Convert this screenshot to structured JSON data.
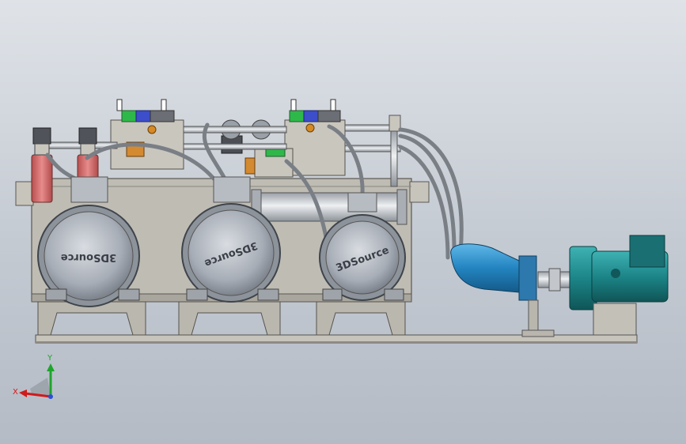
{
  "view": {
    "background_top": "#dfe3e8",
    "background_bottom": "#b4bbc5"
  },
  "motors": {
    "brand_text": "3DSource",
    "count": 3
  },
  "triad": {
    "x_label": "X",
    "y_label": "Y",
    "x_color": "#d11a1a",
    "y_color": "#1ea52c",
    "z_color": "#2b4fd6"
  },
  "colors": {
    "frame": "#b9b6ae",
    "motor": "#aeb3bb",
    "pump": "#2c8fc8",
    "drive_motor": "#1f8c8f",
    "valve_green": "#2fb84a",
    "valve_blue": "#3c4ec9",
    "filter": "#d46b6b",
    "hose": "#7a7f86"
  }
}
